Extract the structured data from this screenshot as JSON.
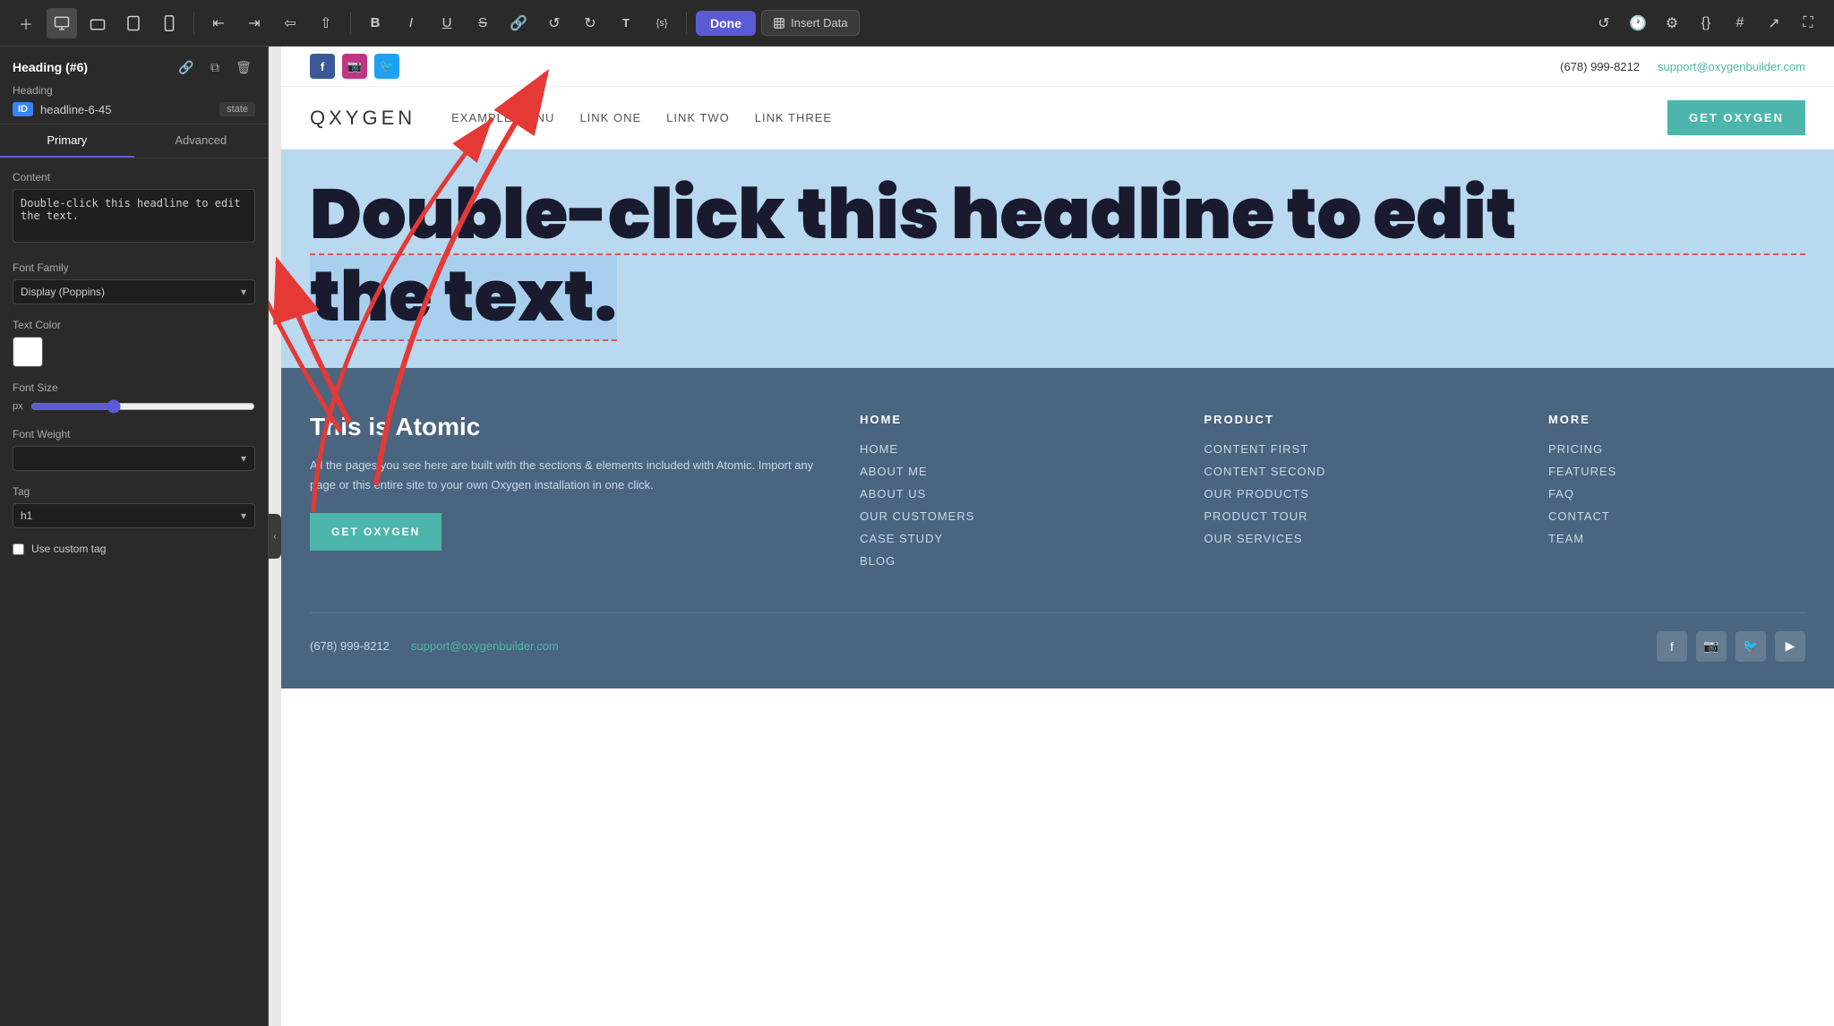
{
  "toolbar": {
    "done_label": "Done",
    "insert_data_label": "Insert Data",
    "align_left": "≡",
    "align_center": "≡",
    "align_right": "≡",
    "align_justify": "≡",
    "bold": "B",
    "italic": "I",
    "underline": "U",
    "strikethrough": "S",
    "link": "🔗",
    "undo": "↺",
    "redo": "↻",
    "typography": "T",
    "code": "{s}"
  },
  "panel": {
    "title": "Heading (#6)",
    "subtitle": "Heading",
    "id": "ID",
    "id_value": "headline-6-45",
    "state_label": "state",
    "primary_tab": "Primary",
    "advanced_tab": "Advanced",
    "content_label": "Content",
    "content_value": "Double-click this headline to edit the text.",
    "font_family_label": "Font Family",
    "font_family_value": "Display (Poppins)",
    "text_color_label": "Text Color",
    "font_size_label": "Font Size",
    "font_size_unit": "px",
    "font_weight_label": "Font Weight",
    "tag_label": "Tag",
    "tag_value": "h1",
    "custom_tag_label": "Use custom tag"
  },
  "site": {
    "topbar": {
      "phone": "(678) 999-8212",
      "email": "support@oxygenbuilder.com"
    },
    "nav": {
      "logo": "QXYGEN",
      "links": [
        "EXAMPLE MENU",
        "LINK ONE",
        "LINK TWO",
        "LINK THREE"
      ],
      "cta": "GET OXYGEN"
    },
    "headline": "Double-click this headline to edit the text.",
    "headline_line1": "Double-click this headline to edit",
    "headline_line2": "the text.",
    "footer": {
      "brand": "This is Atomic",
      "description": "All the pages you see here are built with the sections & elements included with Atomic. Import any page or this entire site to your own Oxygen installation in one click.",
      "cta": "GET OXYGEN",
      "col1_title": "HOME",
      "col1_links": [
        "HOME",
        "ABOUT ME",
        "ABOUT US",
        "OUR CUSTOMERS",
        "CASE STUDY",
        "BLOG"
      ],
      "col2_title": "PRODUCT",
      "col2_links": [
        "CONTENT FIRST",
        "CONTENT SECOND",
        "OUR PRODUCTS",
        "PRODUCT TOUR",
        "OUR SERVICES"
      ],
      "col3_title": "MORE",
      "col3_links": [
        "PRICING",
        "FEATURES",
        "FAQ",
        "CONTACT",
        "TEAM"
      ],
      "bottom_phone": "(678) 999-8212",
      "bottom_email": "support@oxygenbuilder.com"
    }
  }
}
